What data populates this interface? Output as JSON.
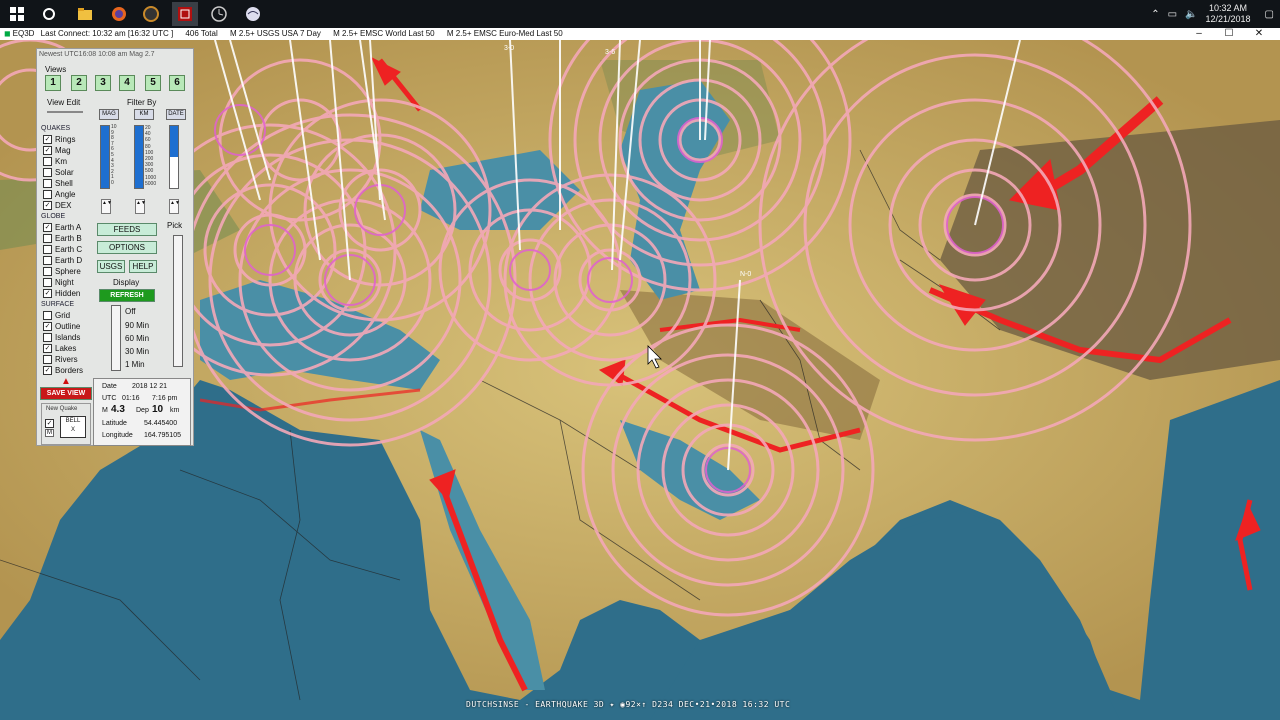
{
  "taskbar": {
    "icons": [
      "windows-start-icon",
      "task-view-icon",
      "file-explorer-icon",
      "firefox-icon",
      "obs-icon",
      "eq3d-app-icon",
      "clock-app-icon",
      "browser-app-icon"
    ],
    "clock_time": "10:32 AM",
    "clock_date": "12/21/2018"
  },
  "titlebar": {
    "app": "EQ3D",
    "connect": "Last Connect: 10:32 am  [16:32 UTC ]",
    "total": "406  Total",
    "feed1": "M 2.5+  USGS USA 7 Day",
    "feed2": "M 2.5+  EMSC World Last 50",
    "feed3": "M 2.5+  EMSC Euro-Med Last 50",
    "minimize": "–",
    "maximize": "☐",
    "close": "✕"
  },
  "panel": {
    "header": "Newest UTC16:08  10:08 am  Mag 2.7",
    "views_label": "Views",
    "views": [
      "1",
      "2",
      "3",
      "4",
      "5",
      "6"
    ],
    "view_edit": "View Edit",
    "filter_by": "Filter By",
    "quakes_label": "QUAKES",
    "quakes": [
      {
        "label": "Rings",
        "checked": true
      },
      {
        "label": "Mag",
        "checked": true
      },
      {
        "label": "Km",
        "checked": false
      },
      {
        "label": "Solar",
        "checked": false
      },
      {
        "label": "Shell",
        "checked": false
      },
      {
        "label": "Angle",
        "checked": false
      },
      {
        "label": "DEX",
        "checked": true
      }
    ],
    "globe_label": "GLOBE",
    "globe": [
      {
        "label": "Earth A",
        "checked": true
      },
      {
        "label": "Earth B",
        "checked": false
      },
      {
        "label": "Earth C",
        "checked": false
      },
      {
        "label": "Earth D",
        "checked": false
      },
      {
        "label": "Sphere",
        "checked": false
      },
      {
        "label": "Night",
        "checked": false
      },
      {
        "label": "Hidden",
        "checked": true
      }
    ],
    "surface_label": "SURFACE",
    "surface": [
      {
        "label": "Grid",
        "checked": false
      },
      {
        "label": "Outline",
        "checked": true
      },
      {
        "label": "Islands",
        "checked": false
      },
      {
        "label": "Lakes",
        "checked": true
      },
      {
        "label": "Rivers",
        "checked": false
      },
      {
        "label": "Borders",
        "checked": true
      }
    ],
    "filter_buttons": [
      "MAG",
      "KM",
      "DATE"
    ],
    "mag_scale": [
      "10",
      "9",
      "8",
      "7",
      "6",
      "5",
      "4",
      "3",
      "2",
      "1",
      "0"
    ],
    "km_scale": [
      "20",
      "40",
      "60",
      "80",
      "100",
      "200",
      "300",
      "500",
      "1000",
      "5000"
    ],
    "feeds_btn": "FEEDS",
    "options_btn": "OPTIONS",
    "usgs_btn": "USGS",
    "help_btn": "HELP",
    "pick_label": "Pick",
    "display_label": "Display",
    "refresh_btn": "REFRESH",
    "display_options": [
      "Off",
      "90 Min",
      "60 Min",
      "30 Min",
      "1 Min"
    ],
    "save_view": "SAVE VIEW",
    "new_quake": "New Quake",
    "bell": "BELL",
    "bell_x": "X",
    "bell_m": "M",
    "info": {
      "date_label": "Date",
      "date": "2018  12  21",
      "utc_label": "UTC",
      "utc": "01:16",
      "local": "7:16 pm",
      "m_label": "M",
      "mag": "4.3",
      "dep_label": "Dep",
      "dep": "10",
      "km": "km",
      "lat_label": "Latitude",
      "lat": "54.445400",
      "lon_label": "Longitude",
      "lon": "164.795105"
    }
  },
  "map": {
    "bottom_label": "DUTCHSINSE - EARTHQUAKE 3D  ✦  ◉92×↑ D234 DEC•21•2018 16:32 UTC",
    "depth_labels": [
      "3-0",
      "3-6",
      "N-0"
    ]
  }
}
